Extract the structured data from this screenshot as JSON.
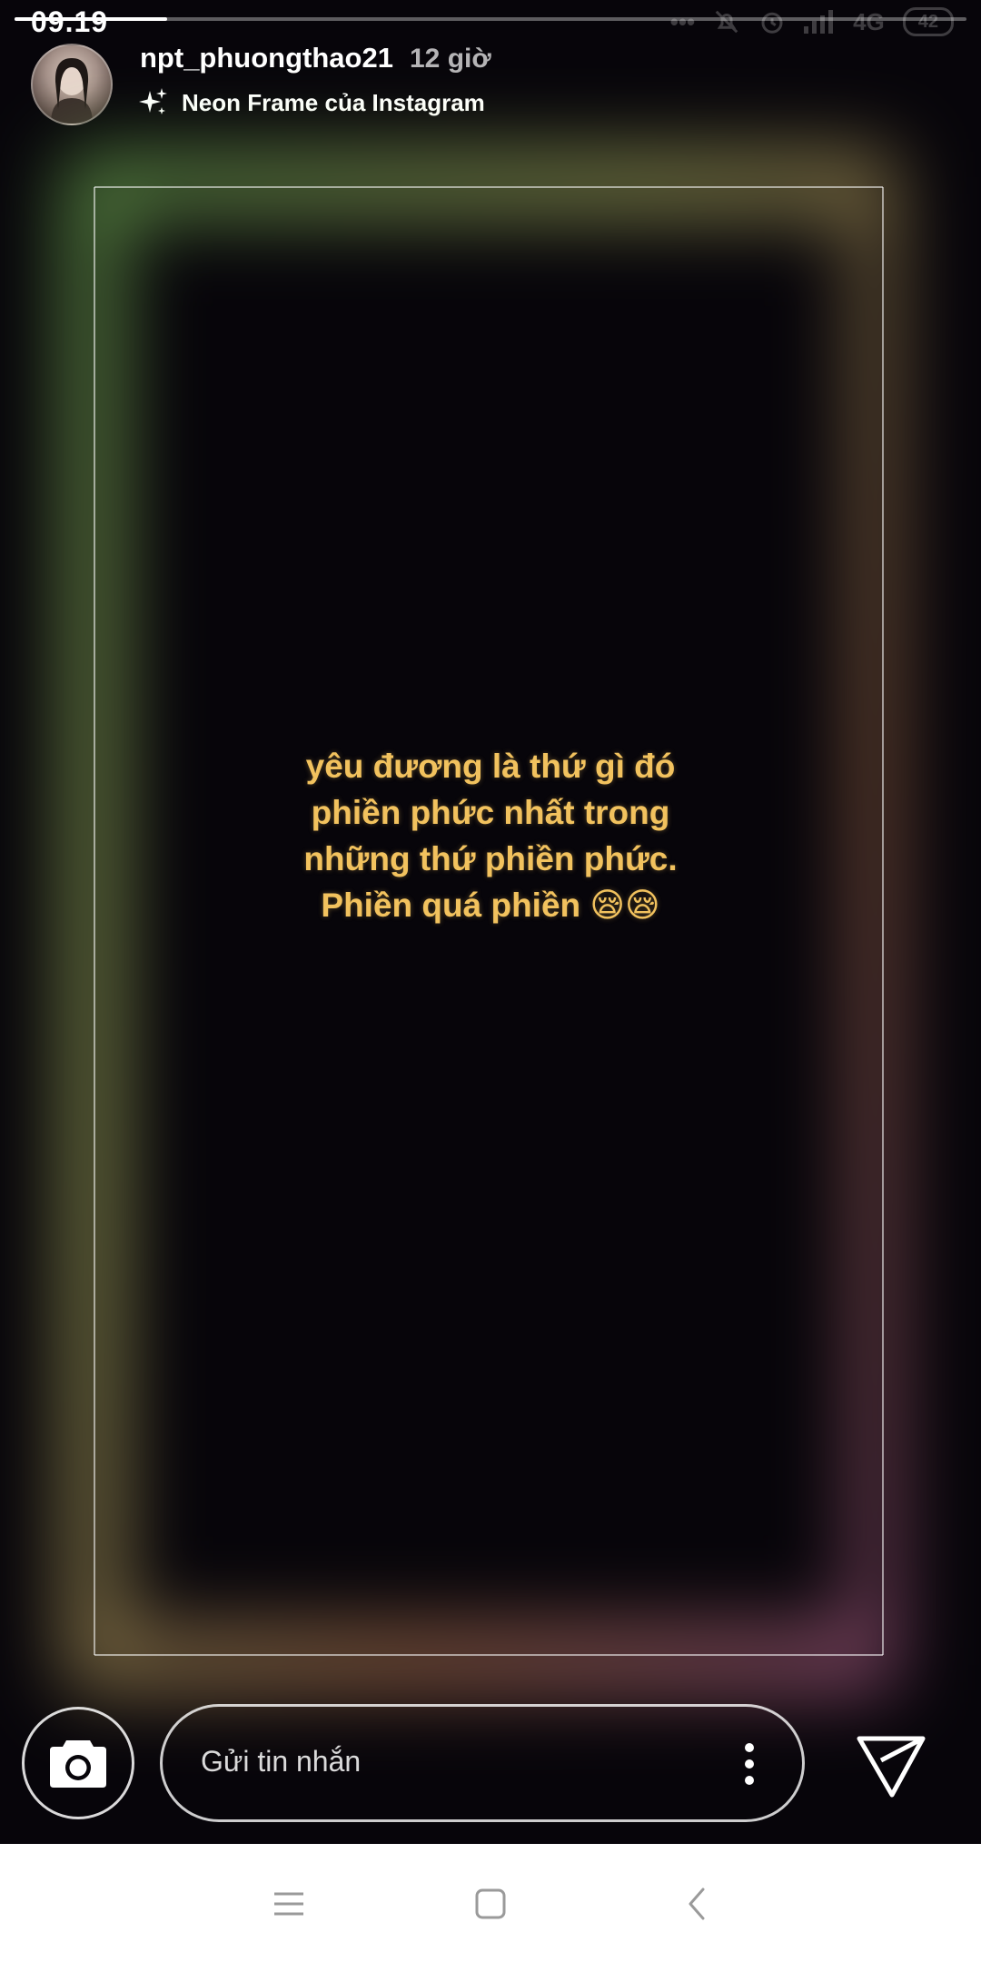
{
  "status_bar": {
    "time": "09.19",
    "network": "4G",
    "battery": "42"
  },
  "progress": {
    "fraction": 0.16
  },
  "header": {
    "username": "npt_phuongthao21",
    "time_ago": "12 giờ",
    "effect_label": "Neon Frame của Instagram",
    "effect_icon": "sparkles-icon"
  },
  "story": {
    "frame_colors": {
      "top_left": "#8fe06a",
      "top_right": "#e8e77a",
      "bottom_left": "#f06a6a",
      "bottom_right": "#e27ab2"
    },
    "text_color": "#f2c25e",
    "text_lines": [
      "yêu đương là thứ gì đó",
      "phiền phức nhất trong",
      "những thứ phiền phức.",
      "Phiền quá phiền 😪😪"
    ]
  },
  "reply_bar": {
    "camera_icon": "camera-icon",
    "message_placeholder": "Gửi tin nhắn",
    "more_icon": "more-vertical-icon",
    "send_icon": "send-icon"
  },
  "nav_bar": {
    "menu_icon": "menu-icon",
    "home_icon": "home-square-icon",
    "back_icon": "back-chevron-icon"
  }
}
